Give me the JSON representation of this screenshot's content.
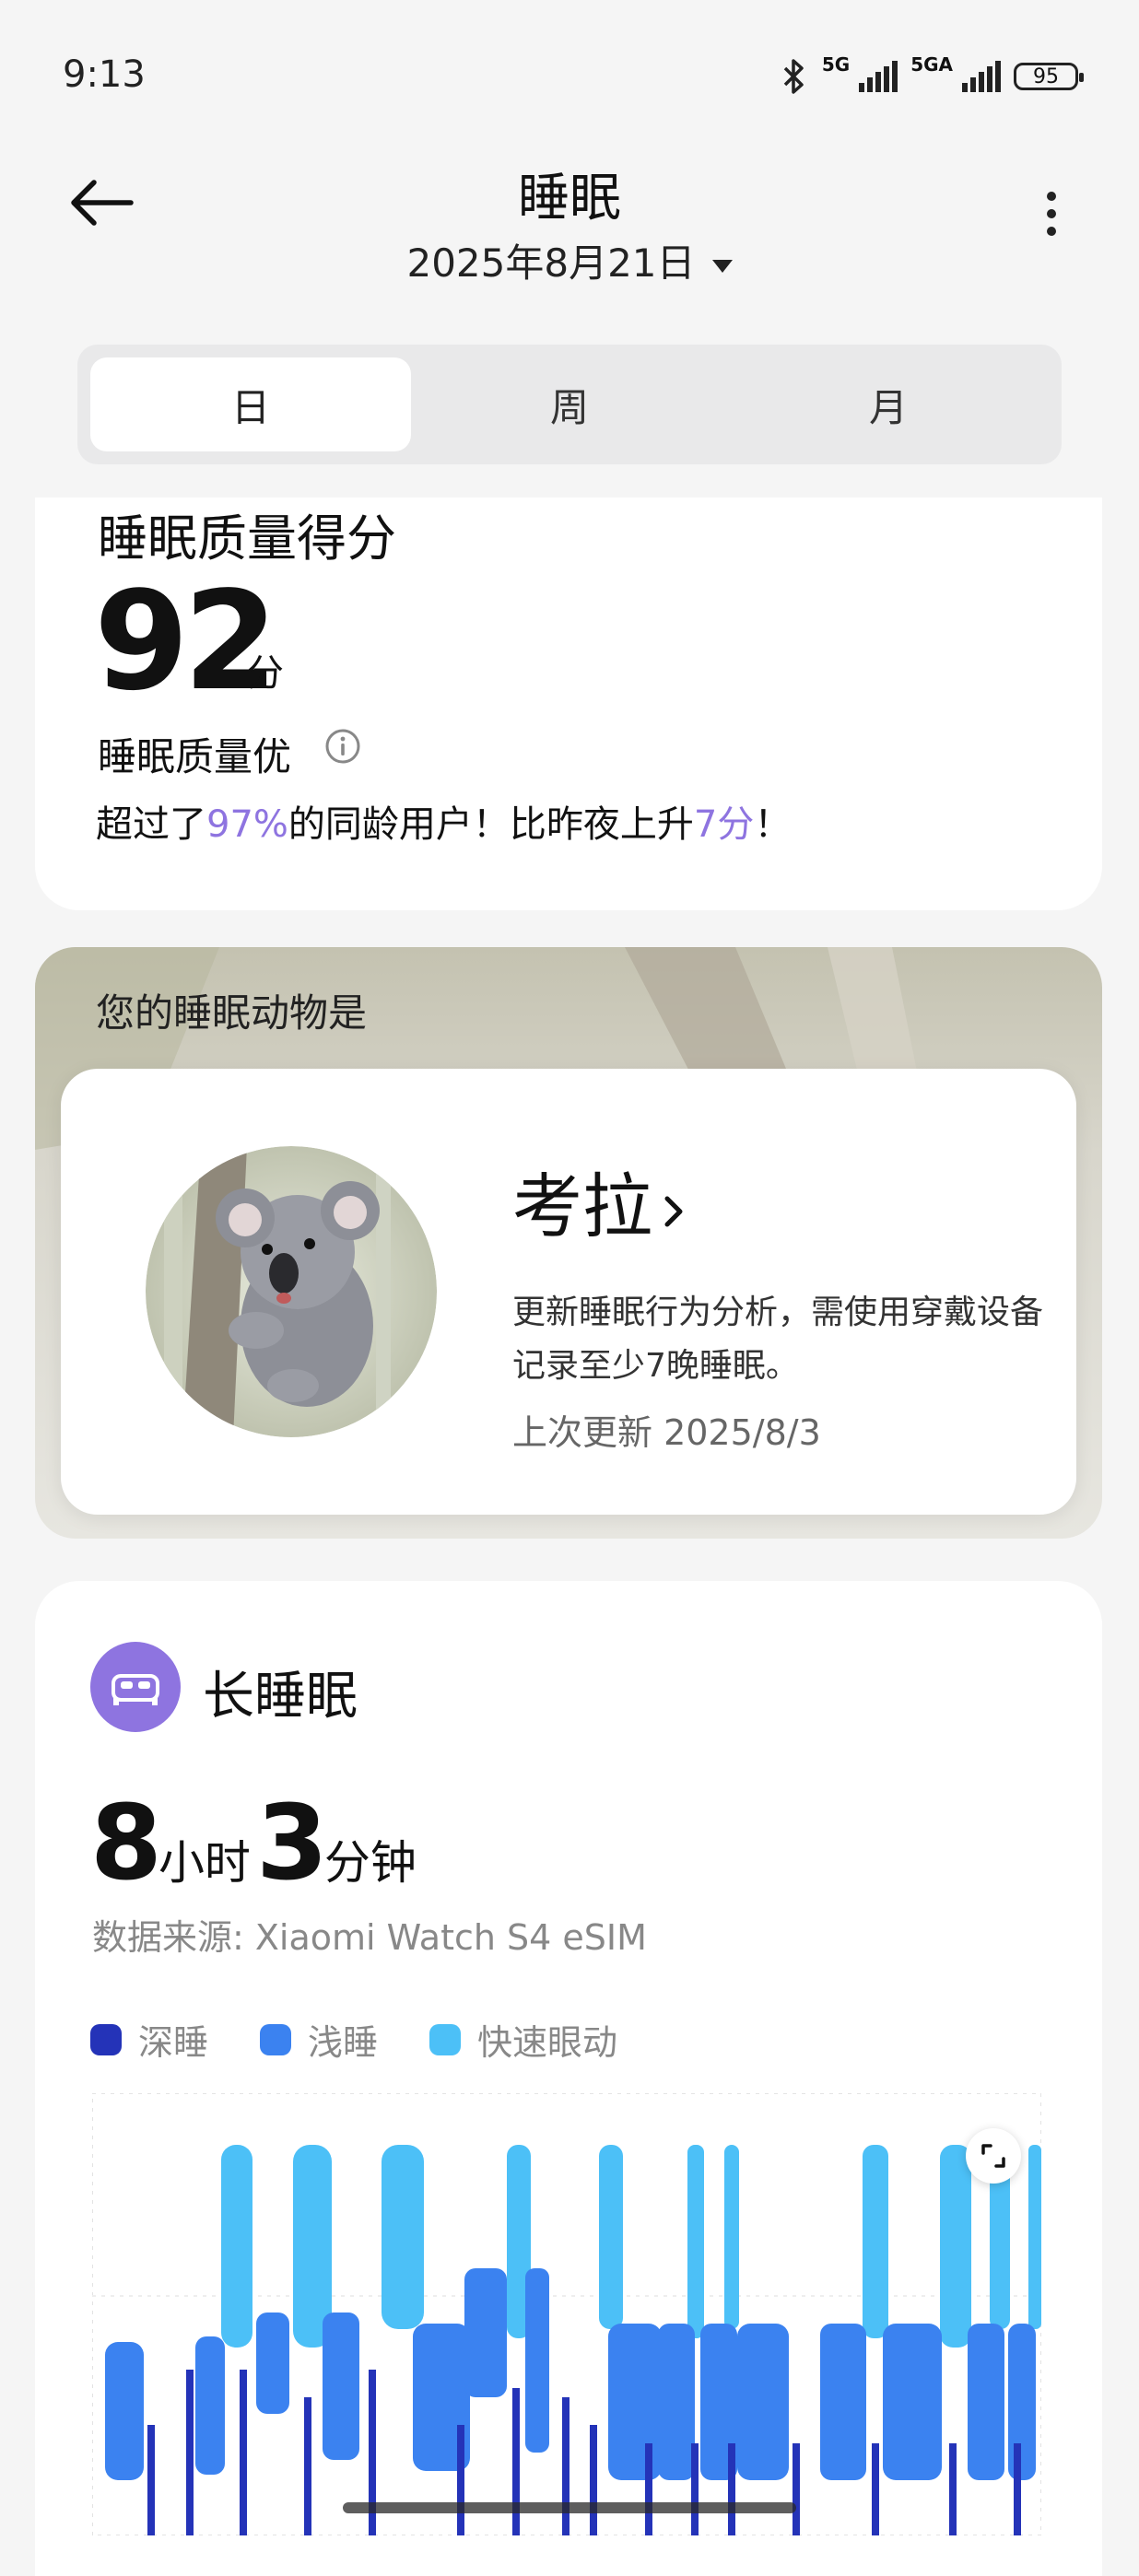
{
  "status_bar": {
    "time": "9:13",
    "signal1": "5G",
    "signal2": "5GA",
    "battery": "95"
  },
  "header": {
    "title": "睡眠",
    "date": "2025年8月21日"
  },
  "tabs": [
    {
      "label": "日",
      "active": true
    },
    {
      "label": "周",
      "active": false
    },
    {
      "label": "月",
      "active": false
    }
  ],
  "score_card": {
    "title": "睡眠质量得分",
    "score": "92",
    "unit": "分",
    "quality": "睡眠质量优",
    "compare_prefix": "超过了",
    "compare_percent": "97%",
    "compare_mid": "的同龄用户！比昨夜上升",
    "compare_rise": "7分",
    "compare_suffix": "！"
  },
  "animal_card": {
    "heading": "您的睡眠动物是",
    "name": "考拉",
    "description": "更新睡眠行为分析，需使用穿戴设备记录至少7晚睡眠。",
    "updated": "上次更新 2025/8/3"
  },
  "sleep_card": {
    "title": "长睡眠",
    "hours": "8",
    "hours_unit": "小时",
    "minutes": "3",
    "minutes_unit": "分钟",
    "source": "数据来源: Xiaomi Watch S4 eSIM",
    "legend": [
      {
        "label": "深睡",
        "color": "#2433b8"
      },
      {
        "label": "浅睡",
        "color": "#3b82f0"
      },
      {
        "label": "快速眼动",
        "color": "#4cc0f7"
      }
    ]
  },
  "colors": {
    "accent": "#8e74e0",
    "deep": "#2433b8",
    "light": "#3b82f0",
    "rem": "#4cc0f7"
  },
  "icons": [
    "back-arrow-icon",
    "dropdown-caret-icon",
    "more-vertical-icon",
    "info-icon",
    "chevron-right-icon",
    "bed-icon",
    "expand-icon",
    "bluetooth-icon",
    "signal-icon",
    "battery-icon"
  ]
}
